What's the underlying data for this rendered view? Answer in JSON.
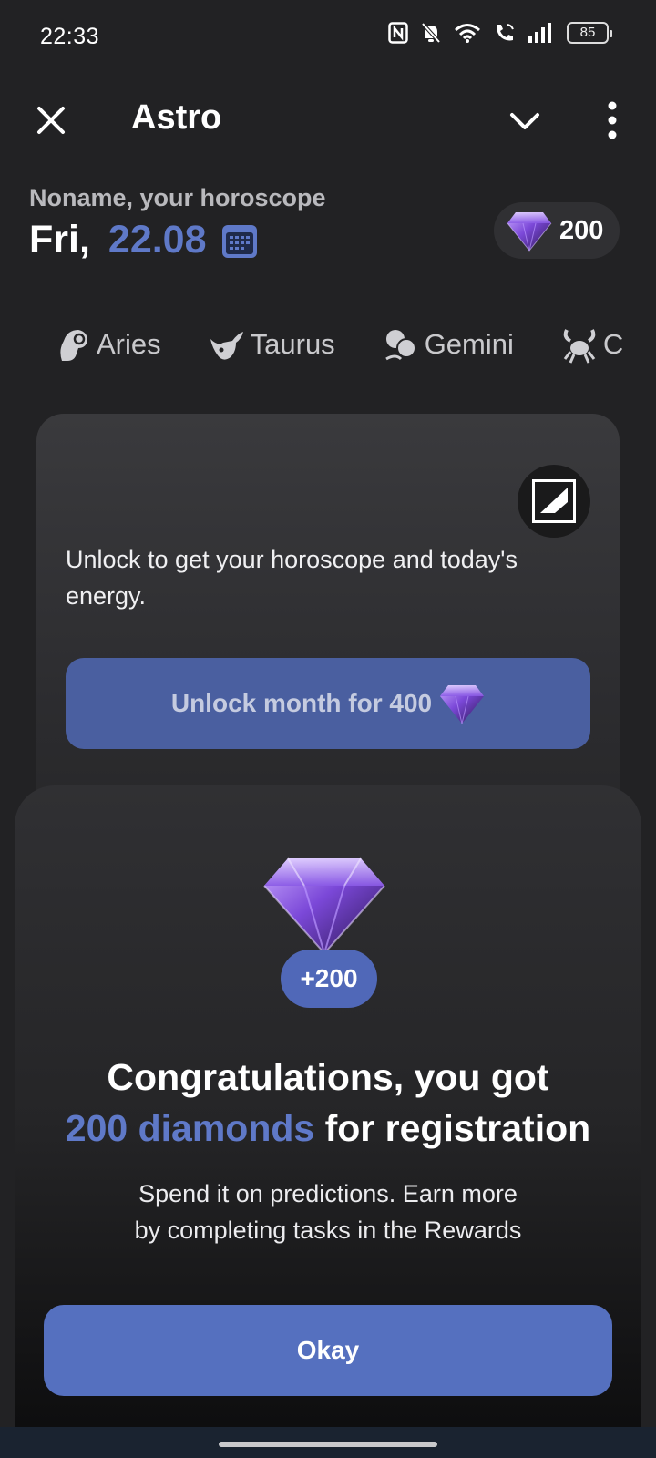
{
  "status_bar": {
    "time": "22:33",
    "battery": "85",
    "icons": [
      "nfc-icon",
      "bell-off-icon",
      "wifi-icon",
      "wifi-calling-icon",
      "signal-icon",
      "battery-icon"
    ]
  },
  "app_bar": {
    "title": "Astro",
    "icons": [
      "close-icon",
      "chevron-down-icon",
      "more-vert-icon"
    ]
  },
  "header": {
    "subtitle": "Noname, your horoscope",
    "day": "Fri,",
    "date": "22.08",
    "balance": "200"
  },
  "zodiac_tabs": [
    {
      "label": "Aries",
      "icon": "aries-icon"
    },
    {
      "label": "Taurus",
      "icon": "taurus-icon"
    },
    {
      "label": "Gemini",
      "icon": "gemini-icon"
    },
    {
      "label": "C",
      "icon": "cancer-icon"
    }
  ],
  "card": {
    "text": "Unlock to get your horoscope and today's energy.",
    "unlock_label": "Unlock month for 400"
  },
  "sheet": {
    "badge": "+200",
    "title_line1": "Congratulations, you got",
    "title_accent": "200 diamonds",
    "title_rest": " for registration",
    "body_line1": "Spend it on predictions. Earn more",
    "body_line2": "by completing tasks in the Rewards",
    "button": "Okay"
  },
  "colors": {
    "accent": "#5F79C8",
    "button": "#5570BF",
    "background": "#222224"
  }
}
